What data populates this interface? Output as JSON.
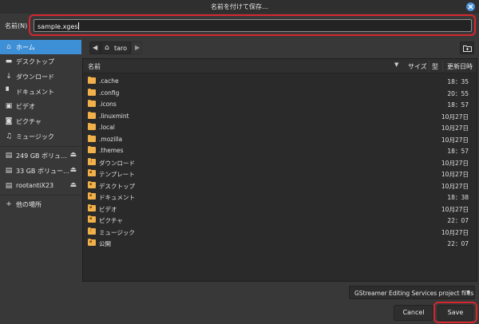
{
  "window": {
    "title": "名前を付けて保存…",
    "close_icon": "close-icon",
    "accent": "#3d8fd6",
    "highlight_color": "#d4272f"
  },
  "name_field": {
    "label": "名前(N)",
    "value": "sample.xges"
  },
  "pathbar": {
    "current": "taro",
    "back_icon": "chevron-left-icon",
    "forward_icon": "chevron-right-icon",
    "home_icon": "home-icon",
    "new_folder_icon": "new-folder-icon"
  },
  "sidebar": {
    "items": [
      {
        "icon": "home-icon",
        "label": "ホーム",
        "selected": true
      },
      {
        "icon": "desktop-icon",
        "label": "デスクトップ"
      },
      {
        "icon": "download-icon",
        "label": "ダウンロード"
      },
      {
        "icon": "document-icon",
        "label": "ドキュメント"
      },
      {
        "icon": "video-icon",
        "label": "ビデオ"
      },
      {
        "icon": "camera-icon",
        "label": "ピクチャ"
      },
      {
        "icon": "music-icon",
        "label": "ミュージック"
      }
    ],
    "volumes": [
      {
        "icon": "drive-icon",
        "label": "249 GB ボリュ…",
        "eject": "eject-icon"
      },
      {
        "icon": "drive-icon",
        "label": "33 GB ボリュー…",
        "eject": "eject-icon"
      },
      {
        "icon": "drive-icon",
        "label": "rootantiX23",
        "eject": "eject-icon"
      }
    ],
    "other": {
      "icon": "plus-icon",
      "label": "他の場所"
    }
  },
  "filelist": {
    "columns": {
      "name": "名前",
      "size": "サイズ",
      "type": "型",
      "modified": "更新日時"
    },
    "rows": [
      {
        "name": ".cache",
        "modified": "18：35"
      },
      {
        "name": ".config",
        "modified": "20：55"
      },
      {
        "name": ".icons",
        "modified": "18：57"
      },
      {
        "name": ".linuxmint",
        "modified": "10月27日"
      },
      {
        "name": ".local",
        "modified": "10月27日"
      },
      {
        "name": ".mozilla",
        "modified": "10月27日"
      },
      {
        "name": ".themes",
        "modified": "18：57"
      },
      {
        "name": "ダウンロード",
        "modified": "10月27日",
        "special": "↓"
      },
      {
        "name": "テンプレート",
        "modified": "10月27日",
        "special": "▪"
      },
      {
        "name": "デスクトップ",
        "modified": "10月27日",
        "special": "▪"
      },
      {
        "name": "ドキュメント",
        "modified": "18：38",
        "special": "▪"
      },
      {
        "name": "ビデオ",
        "modified": "10月27日",
        "special": "▪"
      },
      {
        "name": "ピクチャ",
        "modified": "22：07",
        "special": "▪"
      },
      {
        "name": "ミュージック",
        "modified": "10月27日",
        "special": "♪"
      },
      {
        "name": "公開",
        "modified": "22：07",
        "special": "▪"
      }
    ]
  },
  "filter": {
    "selected": "GStreamer Editing Services project files"
  },
  "buttons": {
    "cancel": "Cancel",
    "save": "Save"
  }
}
